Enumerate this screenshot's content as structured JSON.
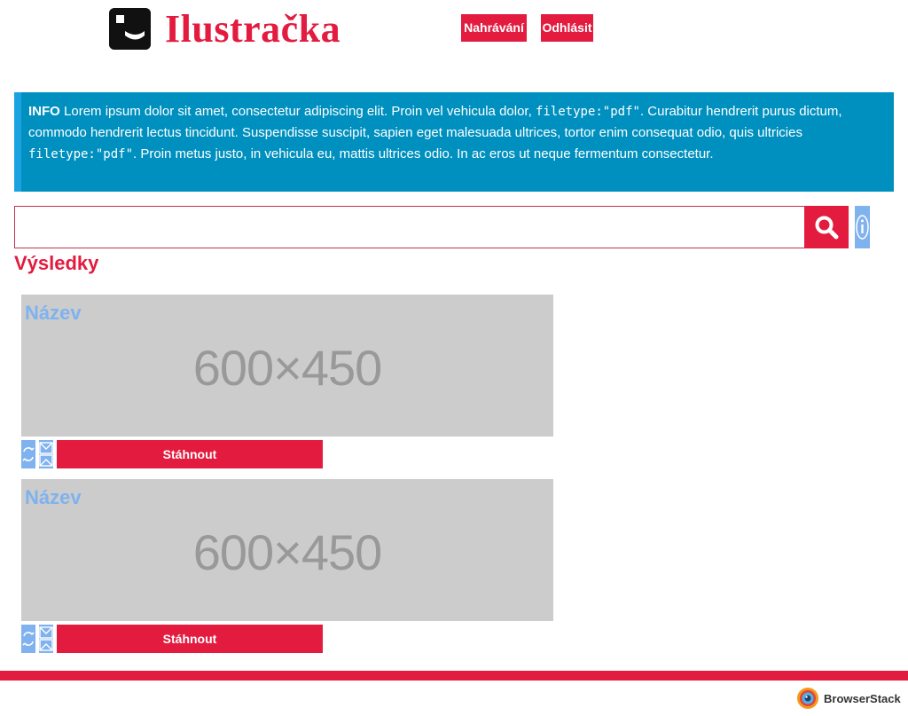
{
  "header": {
    "logo_text": "Ilustračka",
    "logo_icon": "logo-mark-icon",
    "nav": {
      "upload_label": "Nahrávání",
      "logout_label": "Odhlásit"
    }
  },
  "info": {
    "label": "INFO",
    "text_1": " Lorem ipsum dolor sit amet, consectetur adipiscing elit. Proin vel vehicula dolor, ",
    "code_1": "filetype:\"pdf\"",
    "text_2": ". Curabitur hendrerit purus dictum, commodo hendrerit lectus tincidunt. Suspendisse suscipit, sapien eget malesuada ultrices, tortor enim consequat odio, quis ultricies ",
    "code_2": "filetype:\"pdf\"",
    "text_3": ". Proin metus justo, in vehicula eu, mattis ultrices odio. In ac eros ut neque fermentum consectetur."
  },
  "search": {
    "value": "",
    "placeholder": "",
    "button_icon": "search-icon",
    "info_icon": "info-icon"
  },
  "results": {
    "title": "Výsledky",
    "items": [
      {
        "title": "Název",
        "placeholder_size": "600×450",
        "download_label": "Stáhnout"
      },
      {
        "title": "Název",
        "placeholder_size": "600×450",
        "download_label": "Stáhnout"
      }
    ]
  },
  "footer": {
    "badge_text": "BrowserStack"
  },
  "colors": {
    "brand_red": "#e31b3f",
    "info_blue": "#0090bf",
    "light_blue": "#7fb2ee",
    "placeholder_gray": "#cccccc"
  }
}
